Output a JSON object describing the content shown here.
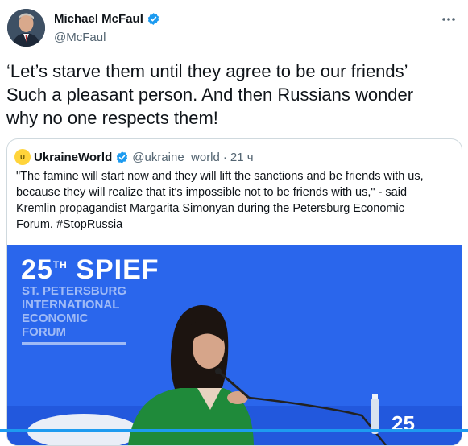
{
  "author": {
    "name": "Michael McFaul",
    "handle": "@McFaul",
    "verified": true
  },
  "more_icon": "more-horizontal-icon",
  "tweet": {
    "lines": [
      "‘Let’s starve them until they agree to be our friends’",
      "Such a pleasant person. And then Russians wonder",
      "why no one respects them!"
    ]
  },
  "quoted_tweet": {
    "avatar_text": "U",
    "name": "UkraineWorld",
    "verified": true,
    "handle": "@ukraine_world",
    "separator": "·",
    "time": "21 ч",
    "lines": [
      "\"The famine will start now and they will lift the sanctions and be friends with us,",
      "because they will realize that it's impossible not to be friends with us,\" - said",
      "Kremlin propagandist Margarita Simonyan during the Petersburg Economic",
      "Forum. #StopRussia"
    ],
    "image": {
      "title_number": "25",
      "title_suffix": "TH",
      "title_word": "SPIEF",
      "subtitle_lines": [
        "ST. PETERSBURG",
        "INTERNATIONAL",
        "ECONOMIC",
        "FORUM"
      ],
      "bottom_text": "25"
    }
  },
  "colors": {
    "accent": "#1d9bf0",
    "stage_blue": "#2f6df0",
    "jacket_green": "#1f8a3a"
  }
}
